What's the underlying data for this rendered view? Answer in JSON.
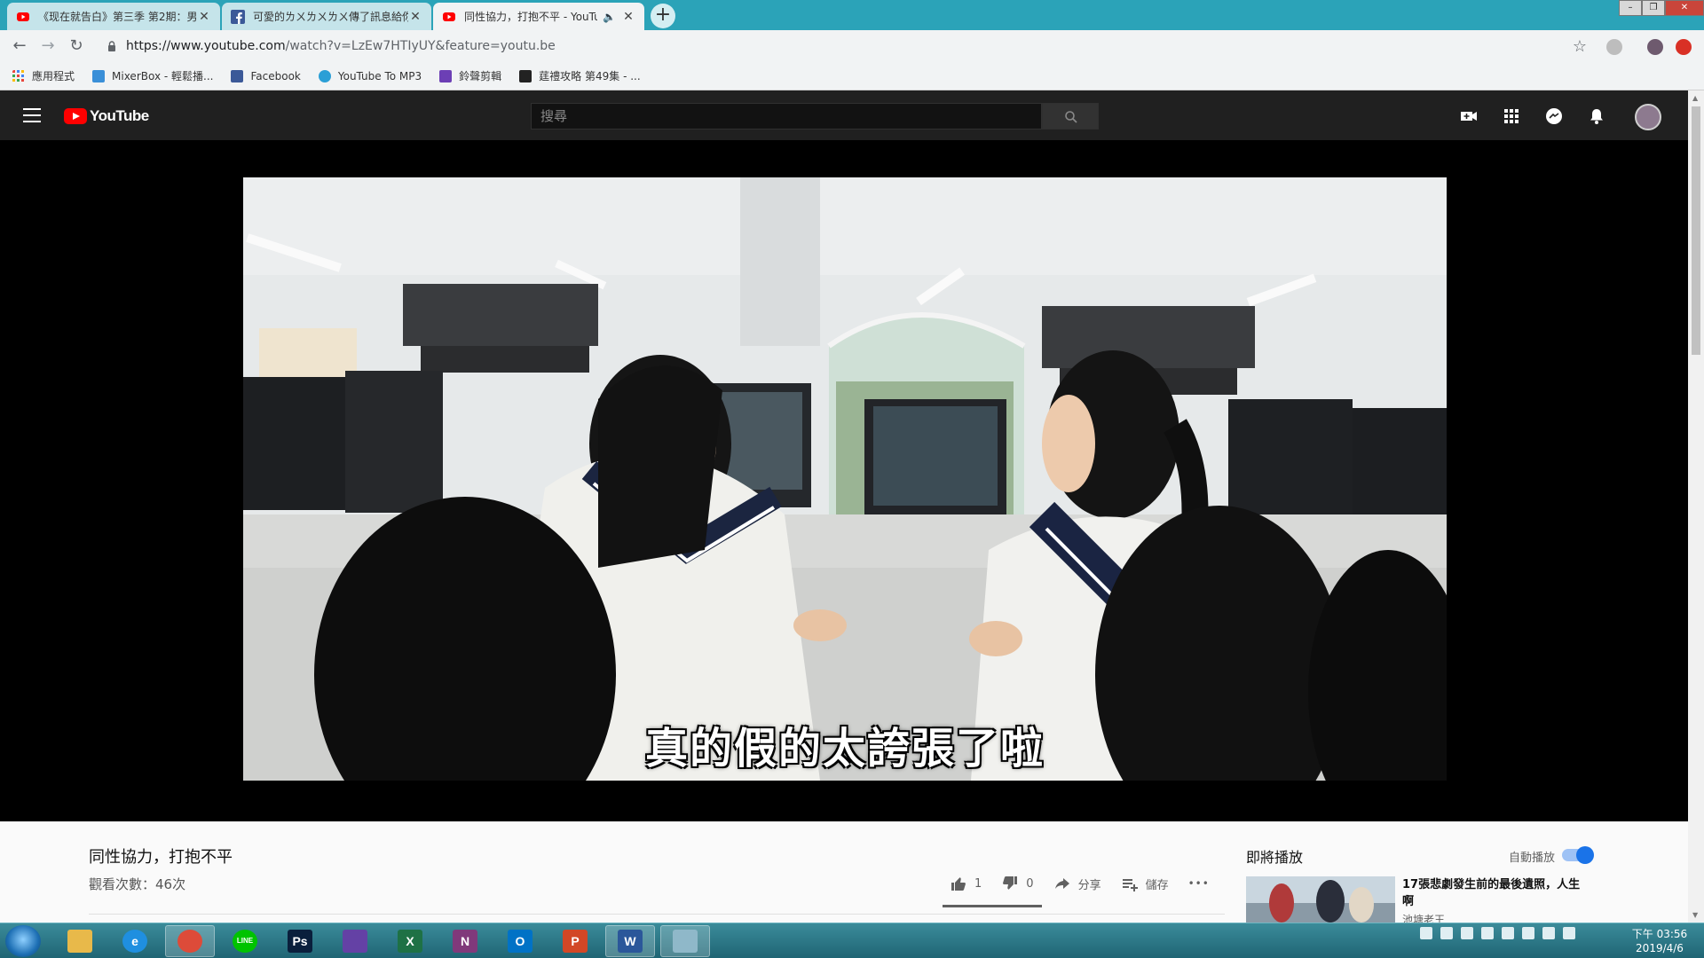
{
  "browser": {
    "tabs": [
      {
        "title": "《现在就告白》第三季 第2期：男...",
        "favicon": "youtube-icon",
        "active": false
      },
      {
        "title": "可愛的ㄌㄨㄌㄨㄌㄨ傳了訊息給你...",
        "favicon": "facebook-icon",
        "active": false
      },
      {
        "title": "同性協力，打抱不平 - YouTu",
        "favicon": "youtube-icon",
        "active": true,
        "audio": "🔈"
      }
    ],
    "close_glyph": "✕",
    "new_tab_glyph": "+",
    "url_host": "https://www.youtube.com",
    "url_path": "/watch?v=LzEw7HTIyUY&feature=youtu.be",
    "bookmarks": [
      {
        "label": "應用程式",
        "icon": "apps-grid-icon",
        "color": "#e8453c"
      },
      {
        "label": "MixerBox - 輕鬆播...",
        "icon": "mixerbox-icon",
        "color": "#3a8fd8"
      },
      {
        "label": "Facebook",
        "icon": "facebook-icon",
        "color": "#3b5998"
      },
      {
        "label": "YouTube To MP3",
        "icon": "ytmp3-icon",
        "color": "#2a9fd6"
      },
      {
        "label": "鈴聲剪輯",
        "icon": "ringtone-icon",
        "color": "#6c3fb5"
      },
      {
        "label": "莛禮攻略 第49集 - ...",
        "icon": "video-icon",
        "color": "#222222"
      }
    ]
  },
  "youtube": {
    "search_placeholder": "搜尋",
    "subtitle": "真的假的太誇張了啦",
    "video_title": "同性協力，打抱不平",
    "views": "觀看次數：46次",
    "likes": "1",
    "dislikes": "0",
    "like_ratio": 1.0,
    "share_label": "分享",
    "save_label": "儲存",
    "more_label": "•••",
    "up_next_label": "即將播放",
    "autoplay_label": "自動播放",
    "autoplay_on": true,
    "rec_title": "17張悲劇發生前的最後遺照，人生啊",
    "rec_channel": "池塘老王"
  },
  "taskbar": {
    "apps": [
      {
        "name": "explorer",
        "icon": "folder-icon",
        "color": "#e8b94a",
        "glyph": ""
      },
      {
        "name": "ie",
        "icon": "internet-explorer-icon",
        "color": "#1f8fe0",
        "glyph": "e"
      },
      {
        "name": "chrome",
        "icon": "chrome-icon",
        "color": "#dd4b39",
        "glyph": "",
        "active": true
      },
      {
        "name": "line",
        "icon": "line-icon",
        "color": "#00c300",
        "glyph": "LINE"
      },
      {
        "name": "photoshop",
        "icon": "photoshop-icon",
        "color": "#0a1f3c",
        "glyph": "Ps"
      },
      {
        "name": "twitch",
        "icon": "twitch-icon",
        "color": "#6441a5",
        "glyph": ""
      },
      {
        "name": "excel",
        "icon": "excel-icon",
        "color": "#1e7145",
        "glyph": "X"
      },
      {
        "name": "onenote",
        "icon": "onenote-icon",
        "color": "#80397b",
        "glyph": "N"
      },
      {
        "name": "outlook",
        "icon": "outlook-icon",
        "color": "#0072c6",
        "glyph": "O"
      },
      {
        "name": "powerpoint",
        "icon": "powerpoint-icon",
        "color": "#d24726",
        "glyph": "P"
      },
      {
        "name": "word",
        "icon": "word-icon",
        "color": "#2b579a",
        "glyph": "W",
        "active": true
      },
      {
        "name": "app",
        "icon": "window-app-icon",
        "color": "#8fb8c9",
        "glyph": "",
        "active": true
      }
    ],
    "time": "下午 03:56",
    "date": "2019/4/6"
  }
}
